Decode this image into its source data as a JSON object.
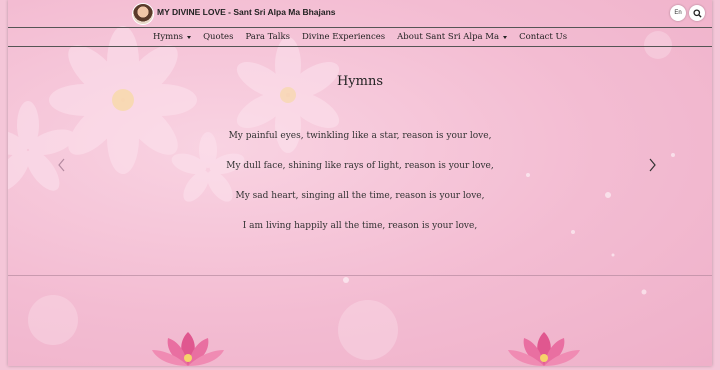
{
  "header": {
    "site_title": "MY DIVINE LOVE - Sant Sri Alpa Ma Bhajans",
    "language_label": "En",
    "search_icon": "search-icon"
  },
  "nav": {
    "items": [
      {
        "label": "Hymns",
        "dropdown": true
      },
      {
        "label": "Quotes",
        "dropdown": false
      },
      {
        "label": "Para Talks",
        "dropdown": false
      },
      {
        "label": "Divine Experiences",
        "dropdown": false
      },
      {
        "label": "About Sant Sri Alpa Ma",
        "dropdown": true
      },
      {
        "label": "Contact Us",
        "dropdown": false
      }
    ]
  },
  "main": {
    "title": "Hymns",
    "lines": [
      "My painful eyes, twinkling like a star, reason is your love,",
      "My dull face, shining like rays of light, reason is your love,",
      "My sad heart, singing all the time, reason is your love,",
      "I am living happily all the time, reason is your love,"
    ]
  },
  "colors": {
    "background": "#f4c6d8",
    "text": "#222222",
    "lotus": "#e0578f"
  }
}
